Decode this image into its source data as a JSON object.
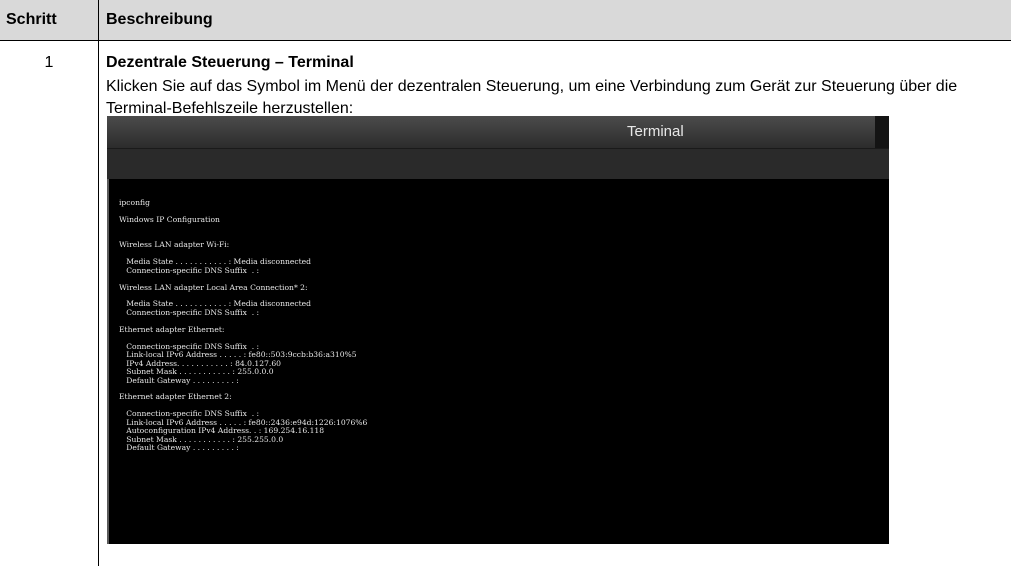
{
  "table": {
    "header": {
      "step": "Schritt",
      "description": "Beschreibung"
    },
    "row": {
      "step": "1",
      "title": "Dezentrale Steuerung – Terminal",
      "text": "Klicken Sie auf das Symbol im Menü der dezentralen Steuerung, um eine Verbindung zum Gerät zur Steuerung über die Terminal-Befehlszeile herzustellen:"
    }
  },
  "terminal": {
    "title": "Terminal",
    "output": "ipconfig\n\nWindows IP Configuration\n\n\nWireless LAN adapter Wi-Fi:\n\n   Media State . . . . . . . . . . . : Media disconnected\n   Connection-specific DNS Suffix  . :\n\nWireless LAN adapter Local Area Connection* 2:\n\n   Media State . . . . . . . . . . . : Media disconnected\n   Connection-specific DNS Suffix  . :\n\nEthernet adapter Ethernet:\n\n   Connection-specific DNS Suffix  . :\n   Link-local IPv6 Address . . . . . : fe80::503:9ccb:b36:a310%5\n   IPv4 Address. . . . . . . . . . . : 84.0.127.60\n   Subnet Mask . . . . . . . . . . . : 255.0.0.0\n   Default Gateway . . . . . . . . . :\n\nEthernet adapter Ethernet 2:\n\n   Connection-specific DNS Suffix  . :\n   Link-local IPv6 Address . . . . . : fe80::2436:e94d:1226:1076%6\n   Autoconfiguration IPv4 Address. . : 169.254.16.118\n   Subnet Mask . . . . . . . . . . . : 255.255.0.0\n   Default Gateway . . . . . . . . . :"
  }
}
